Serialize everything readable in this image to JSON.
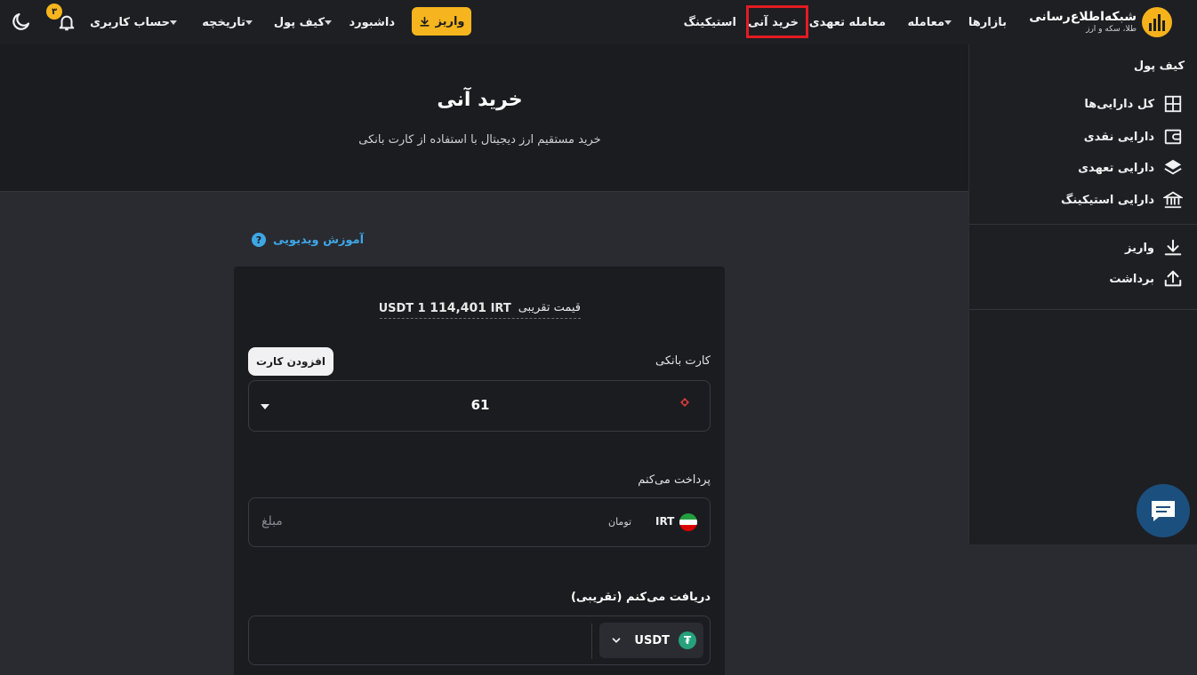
{
  "nav": {
    "brand_title": "شبکه‌اطلاع‌رسانی",
    "brand_subtitle": "طلا، سکه و ارز",
    "items": {
      "markets": "بازارها",
      "trade": "معامله",
      "margin_trade": "معامله تعهدی",
      "instant_buy": "خرید آنی",
      "staking": "استیکینگ",
      "deposit": "واریز",
      "dashboard": "داشبورد",
      "wallet": "کیف پول",
      "history": "تاریخچه",
      "account": "حساب کاربری"
    },
    "notification_count": "۳"
  },
  "hero": {
    "title": "خرید آنی",
    "subtitle": "خرید مستقیم ارز دیجیتال با استفاده از کارت بانکی"
  },
  "sidebar": {
    "title": "کیف پول",
    "items": [
      {
        "label": "کل دارایی‌ها",
        "icon": "grid-icon"
      },
      {
        "label": "دارایی نقدی",
        "icon": "wallet-icon"
      },
      {
        "label": "دارایی تعهدی",
        "icon": "layers-icon"
      },
      {
        "label": "دارایی استیکینگ",
        "icon": "bank-icon"
      },
      {
        "label": "واریز",
        "icon": "download-icon"
      },
      {
        "label": "برداشت",
        "icon": "upload-icon"
      }
    ]
  },
  "video_link": "آموزش ویدیویی",
  "form": {
    "price_label": "قیمت تقریبی",
    "price_rate_currency": "IRT",
    "price_rate_value": "114,401",
    "price_rate_suffix": "≈ USDT 1",
    "bank_card_label": "کارت بانکی",
    "add_card_button": "افزودن کارت",
    "card_number": "61",
    "pay_label": "پرداخت می‌کنم",
    "pay_currency_code": "IRT",
    "pay_currency_unit": "تومان",
    "amount_placeholder": "مبلغ",
    "receive_label": "دریافت می‌کنم (تقریبی)",
    "receive_coin": "USDT"
  },
  "colors": {
    "accent": "#f6b51e",
    "highlight": "#e31b23",
    "link": "#3ea6e5",
    "tether": "#26a17b"
  }
}
